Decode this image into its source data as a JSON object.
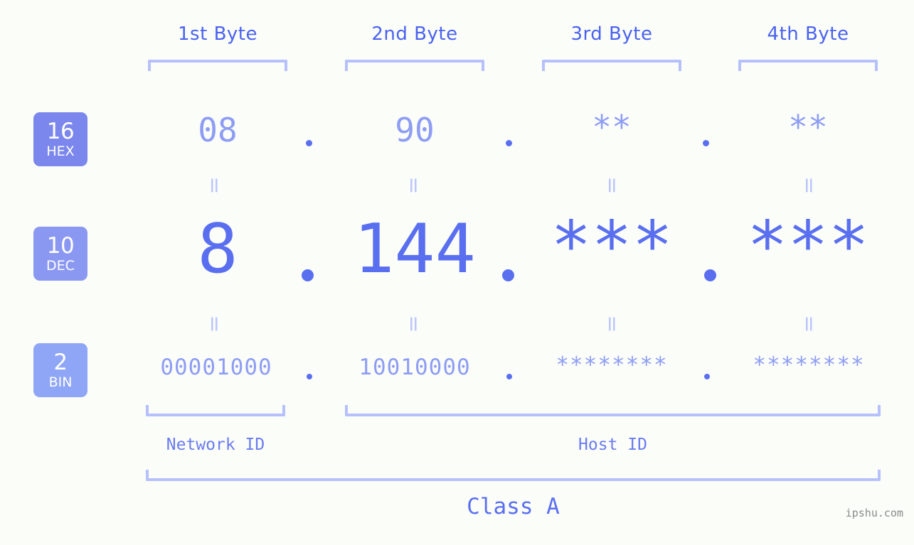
{
  "meta": {
    "background": "#fbfdf9",
    "watermark": "ipshu.com"
  },
  "byte_headers": [
    {
      "label": "1st Byte"
    },
    {
      "label": "2nd Byte"
    },
    {
      "label": "3rd Byte"
    },
    {
      "label": "4th Byte"
    }
  ],
  "rows": [
    {
      "id": "hex",
      "badge_number": "16",
      "badge_abbr": "HEX",
      "badge_color": "#7b87ec",
      "text_color": "#8e9df4",
      "separator": ".",
      "values": [
        "08",
        "90",
        "**",
        "**"
      ]
    },
    {
      "id": "dec",
      "badge_number": "10",
      "badge_abbr": "DEC",
      "badge_color": "#8b98f2",
      "text_color": "#5a6ff0",
      "separator": ".",
      "values": [
        "8",
        "144",
        "***",
        "***"
      ]
    },
    {
      "id": "bin",
      "badge_number": "2",
      "badge_abbr": "BIN",
      "badge_color": "#8fa6f6",
      "text_color": "#8e9df4",
      "separator": ".",
      "values": [
        "00001000",
        "10010000",
        "********",
        "********"
      ]
    }
  ],
  "equals_symbol": "=",
  "segments": {
    "network_id": "Network ID",
    "host_id": "Host ID",
    "class": "Class A"
  },
  "colors": {
    "bracket": "#b6c0fb",
    "header_text": "#4a62f0",
    "accent": "#5a6ff0"
  }
}
